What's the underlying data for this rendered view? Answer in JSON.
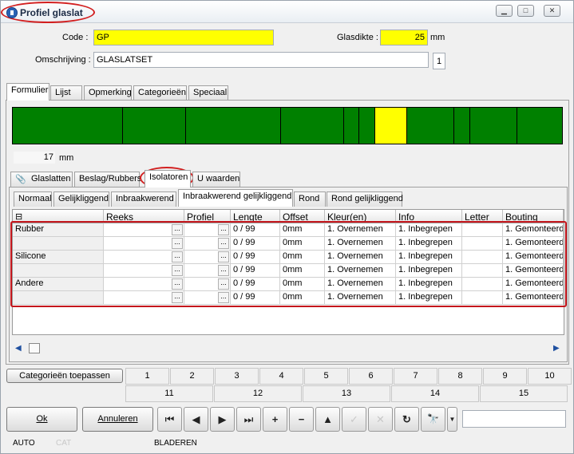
{
  "window": {
    "title": "Profiel glaslat",
    "minimize": "▁",
    "maximize": "□",
    "close": "✕"
  },
  "form": {
    "code_label": "Code :",
    "code_value": "GP",
    "glasdikte_label": "Glasdikte :",
    "glasdikte_value": "25",
    "glasdikte_unit": "mm",
    "omschrijving_label": "Omschrijving :",
    "omschrijving_value": "GLASLATSET",
    "counter": "1"
  },
  "top_tabs": [
    "Formulier",
    "Lijst",
    "Opmerking",
    "Categorieën",
    "Speciaal"
  ],
  "strip": {
    "measure_value": "17",
    "measure_unit": "mm",
    "green": "#008000",
    "highlight": "#ffff00"
  },
  "section_tabs": [
    "Glaslatten",
    "Beslag/Rubbers",
    "Isolatoren",
    "U waarden"
  ],
  "sub_tabs": [
    "Normaal",
    "Gelijkliggend",
    "Inbraakwerend",
    "Inbraakwerend gelijkliggend",
    "Rond",
    "Rond gelijkliggend"
  ],
  "grid": {
    "collapse_symbol": "⊟",
    "headers": [
      "Reeks",
      "Profiel",
      "Lengte",
      "Offset",
      "Kleur(en)",
      "Info",
      "Letter",
      "Bouting"
    ],
    "rows": [
      {
        "name": "Rubber",
        "lengte": "0 / 99",
        "offset": "0mm",
        "kleur": "1. Overnemen",
        "info": "1. Inbegrepen",
        "bouting": "1. Gemonteerd"
      },
      {
        "name": "",
        "lengte": "0 / 99",
        "offset": "0mm",
        "kleur": "1. Overnemen",
        "info": "1. Inbegrepen",
        "bouting": "1. Gemonteerd"
      },
      {
        "name": "Silicone",
        "lengte": "0 / 99",
        "offset": "0mm",
        "kleur": "1. Overnemen",
        "info": "1. Inbegrepen",
        "bouting": "1. Gemonteerd"
      },
      {
        "name": "",
        "lengte": "0 / 99",
        "offset": "0mm",
        "kleur": "1. Overnemen",
        "info": "1. Inbegrepen",
        "bouting": "1. Gemonteerd"
      },
      {
        "name": "Andere",
        "lengte": "0 / 99",
        "offset": "0mm",
        "kleur": "1. Overnemen",
        "info": "1. Inbegrepen",
        "bouting": "1. Gemonteerd"
      },
      {
        "name": "",
        "lengte": "0 / 99",
        "offset": "0mm",
        "kleur": "1. Overnemen",
        "info": "1. Inbegrepen",
        "bouting": "1. Gemonteerd"
      }
    ],
    "dots": "..."
  },
  "categories": {
    "apply_label": "Categorieën toepassen",
    "row1": [
      "1",
      "2",
      "3",
      "4",
      "5",
      "6",
      "7",
      "8",
      "9",
      "10"
    ],
    "row2": [
      "11",
      "12",
      "13",
      "14",
      "15"
    ]
  },
  "buttons": {
    "ok": "Ok",
    "annuleren": "Annuleren"
  },
  "nav": {
    "first": "⏮",
    "prev": "◀",
    "next": "▶",
    "last": "⏭",
    "add": "+",
    "remove": "−",
    "up": "▲",
    "confirm": "✓",
    "cancel": "✕",
    "refresh": "↻",
    "find": "🔭"
  },
  "status": {
    "mode": "AUTO",
    "cat": "CAT",
    "state": "BLADEREN"
  }
}
